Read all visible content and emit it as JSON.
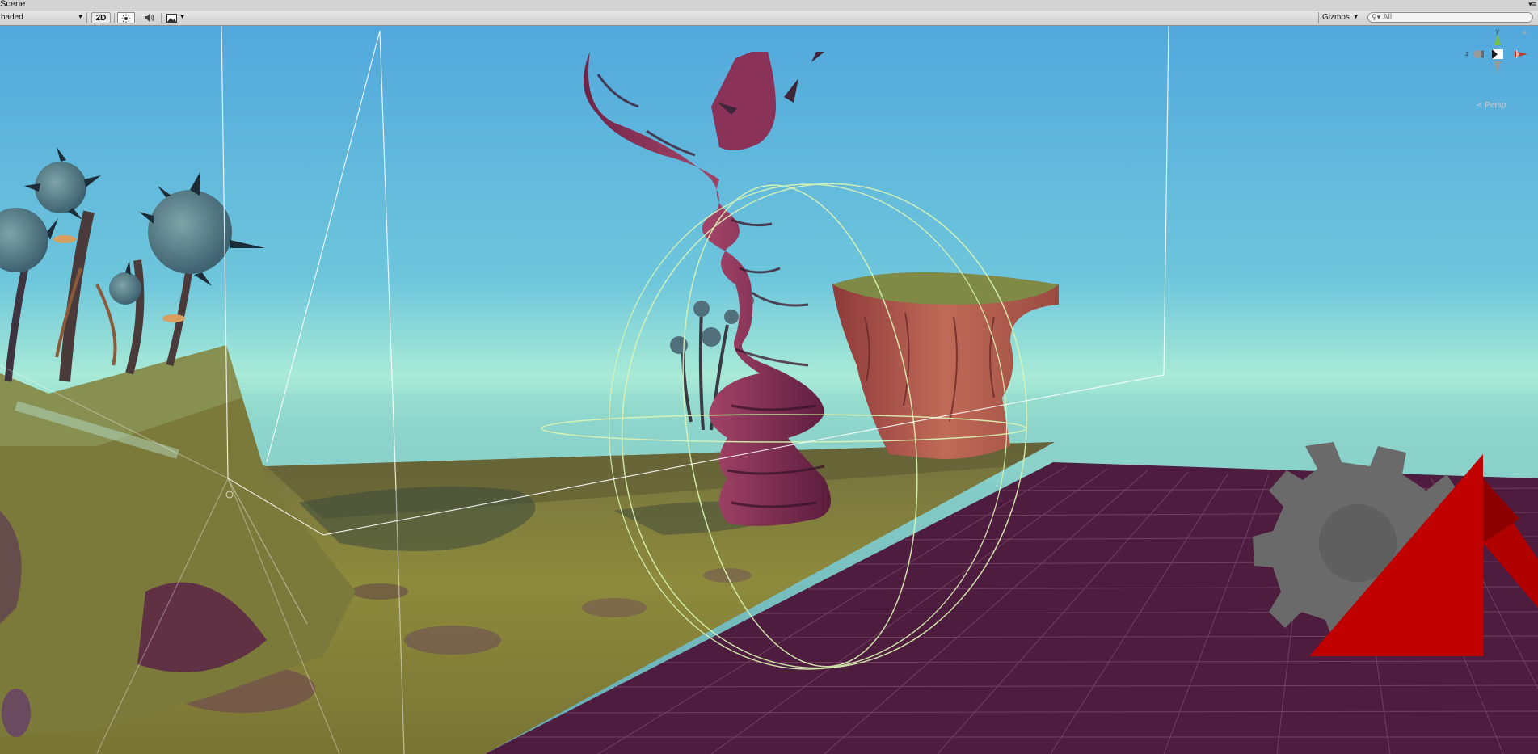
{
  "tab": {
    "title": "Scene",
    "menu_icon": "▾≡"
  },
  "toolbar": {
    "shading_mode": "haded",
    "btn_2d": "2D",
    "lighting_icon": "sun-icon",
    "audio_icon": "speaker-icon",
    "effects_icon": "image-icon",
    "gizmos_label": "Gizmos",
    "search_placeholder": "All"
  },
  "scene_gizmo": {
    "y_label": "y",
    "z_label": "z",
    "projection_label": "≺ Persp"
  },
  "colors": {
    "sky_top": "#56aedc",
    "sky_horizon": "#a8ead6",
    "grid_floor": "#4e1c3e",
    "terrain": "#8e8a3a",
    "gizmo_wire": "#dcf5b4",
    "logo_red": "#c00000",
    "logo_gray": "#6e6e6e"
  }
}
